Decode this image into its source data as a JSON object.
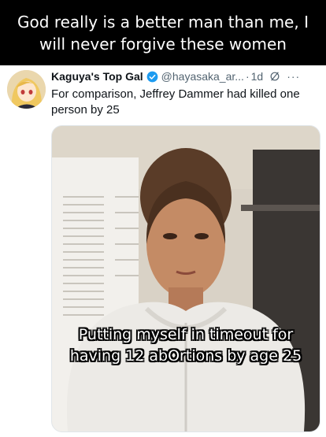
{
  "meme": {
    "headline": "God really is a better man than me, I will never forgive these women"
  },
  "tweet": {
    "author_name": "Kaguya's Top Gal",
    "handle": "@hayasaka_ar...",
    "time": "1d",
    "text": "For comparison, Jeffrey Dammer had killed one person by 25",
    "media_caption": "Putting myself in timeout for having 12 abOrtions by age 25",
    "icons": {
      "verified": "verified-badge-icon",
      "grok": "grok-icon",
      "more": "more-icon"
    },
    "colors": {
      "verified": "#1d9bf0",
      "secondary_text": "#536471",
      "primary_text": "#0f1419"
    }
  }
}
